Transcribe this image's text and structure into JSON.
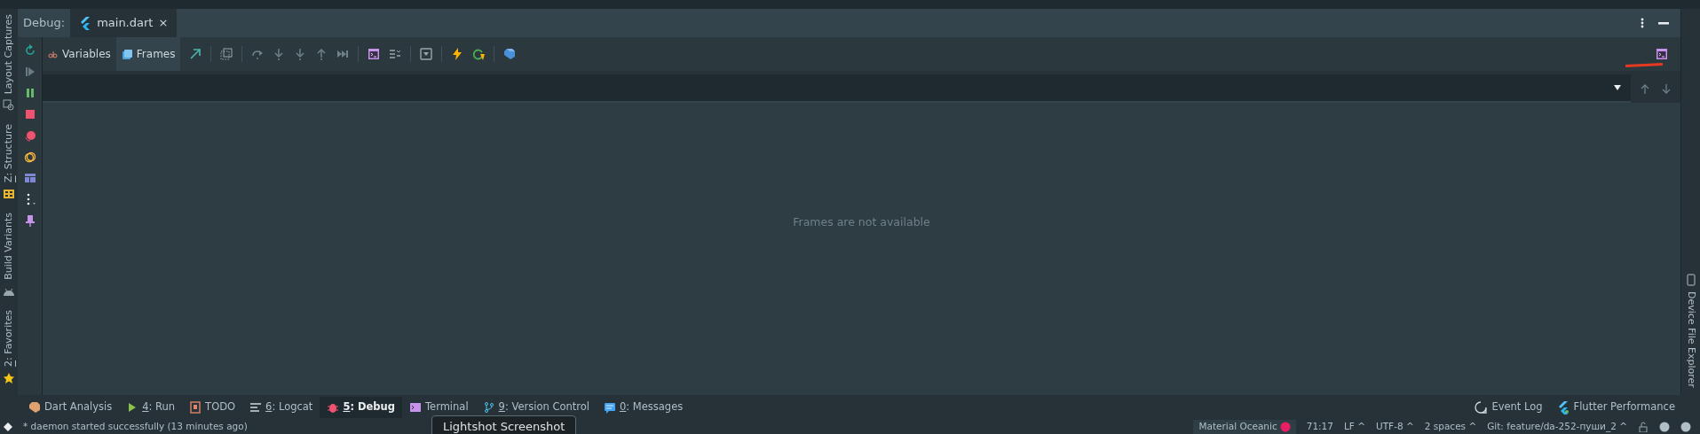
{
  "left_stripe": {
    "items": [
      {
        "label": "Layout Captures",
        "underline_first": false
      },
      {
        "label": "Z: Structure",
        "underline_first": true
      },
      {
        "label": "Build Variants",
        "underline_first": false
      },
      {
        "label": "2: Favorites",
        "underline_first": true
      }
    ]
  },
  "right_stripe": {
    "items": [
      {
        "label": "Device File Explorer",
        "underline_first": false
      }
    ]
  },
  "debug_header": {
    "label": "Debug:",
    "tabs": [
      {
        "label": "main.dart",
        "selected": true,
        "close": "×"
      }
    ]
  },
  "toolbar": {
    "tabs": [
      {
        "label": "Variables",
        "selected": false
      },
      {
        "label": "Frames",
        "selected": true
      }
    ]
  },
  "empty_message": "Frames are not available",
  "bottom_tools": {
    "left": [
      {
        "label": "Dart Analysis",
        "underline_first": false,
        "selected": false
      },
      {
        "label": "4: Run",
        "underline_first": true,
        "selected": false
      },
      {
        "label": "TODO",
        "underline_first": false,
        "selected": false
      },
      {
        "label": "6: Logcat",
        "underline_first": true,
        "selected": false
      },
      {
        "label": "5: Debug",
        "underline_first": true,
        "selected": true
      },
      {
        "label": "Terminal",
        "underline_first": false,
        "selected": false
      },
      {
        "label": "9: Version Control",
        "underline_first": true,
        "selected": false
      },
      {
        "label": "0: Messages",
        "underline_first": true,
        "selected": false
      }
    ],
    "right": [
      {
        "label": "Event Log"
      },
      {
        "label": "Flutter Performance"
      }
    ]
  },
  "tooltip": "Lightshot Screenshot",
  "status_bar": {
    "message": "* daemon started successfully (13 minutes ago)",
    "theme": "Material Oceanic",
    "items": [
      "71:17",
      "LF ^",
      "UTF-8 ^",
      "2 spaces ^",
      "Git: feature/da-252-пуши_2 ^"
    ]
  }
}
